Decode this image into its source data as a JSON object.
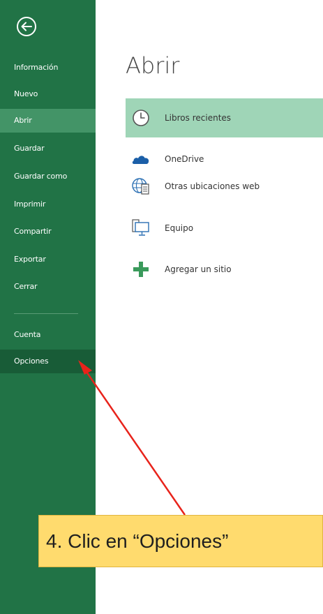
{
  "sidebar": {
    "back_icon": "back-arrow-circle-icon",
    "items": [
      {
        "label": "Información"
      },
      {
        "label": "Nuevo"
      },
      {
        "label": "Abrir"
      },
      {
        "label": "Guardar"
      },
      {
        "label": "Guardar como"
      },
      {
        "label": "Imprimir"
      },
      {
        "label": "Compartir"
      },
      {
        "label": "Exportar"
      },
      {
        "label": "Cerrar"
      }
    ],
    "bottom_items": [
      {
        "label": "Cuenta"
      },
      {
        "label": "Opciones"
      }
    ]
  },
  "main": {
    "title": "Abrir",
    "locations": [
      {
        "label": "Libros recientes",
        "icon": "clock-icon"
      },
      {
        "label": "OneDrive",
        "icon": "cloud-icon"
      },
      {
        "label": "Otras ubicaciones web",
        "icon": "globe-icon"
      },
      {
        "label": "Equipo",
        "icon": "computer-icon"
      },
      {
        "label": "Agregar un sitio",
        "icon": "plus-icon"
      }
    ]
  },
  "callout": {
    "text": "4. Clic en “Opciones”"
  },
  "colors": {
    "sidebar_bg": "#217346",
    "sidebar_active": "#439467",
    "sidebar_selected": "#185c37",
    "location_active": "#9fd5b7",
    "callout_bg": "#ffdb6e",
    "arrow": "#e8231b"
  }
}
